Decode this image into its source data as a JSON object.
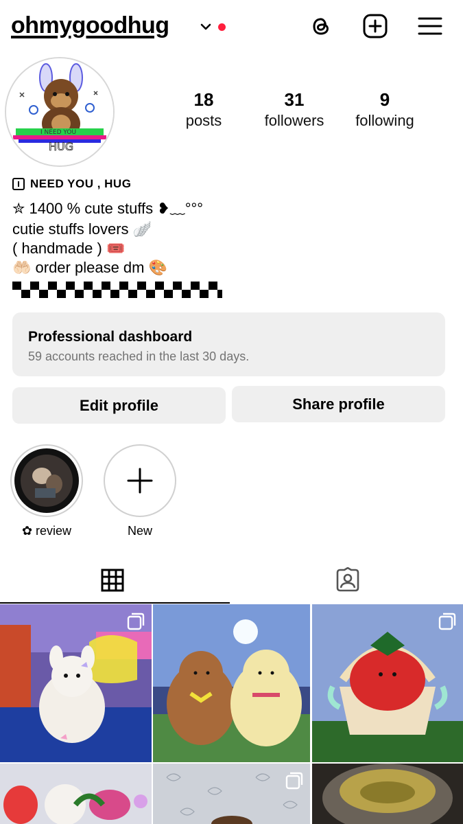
{
  "header": {
    "username": "ohmygoodhug",
    "icons": [
      "threads-icon",
      "create-post-icon",
      "menu-icon"
    ]
  },
  "stats": [
    {
      "num": "18",
      "label": "posts"
    },
    {
      "num": "31",
      "label": "followers"
    },
    {
      "num": "9",
      "label": "following"
    }
  ],
  "bio": {
    "category": "NEED YOU , HUG",
    "lines": [
      "✮ 1400 % cute stuffs ❥﹏°°°",
      "cutie stuffs lovers 🪽",
      "( handmade ) 🎟️",
      "🤲🏻 order please dm 🎨"
    ]
  },
  "dashboard": {
    "title": "Professional dashboard",
    "subtitle": "59 accounts reached in the last 30 days."
  },
  "buttons": {
    "edit": "Edit profile",
    "share": "Share profile"
  },
  "highlights": [
    {
      "label": "✿ review"
    },
    {
      "label": "New"
    }
  ],
  "tabs": [
    "grid-icon",
    "tagged-icon"
  ],
  "colors": {
    "accent_red": "#ff1f3d",
    "button_bg": "#efefef",
    "muted_text": "#737373"
  }
}
